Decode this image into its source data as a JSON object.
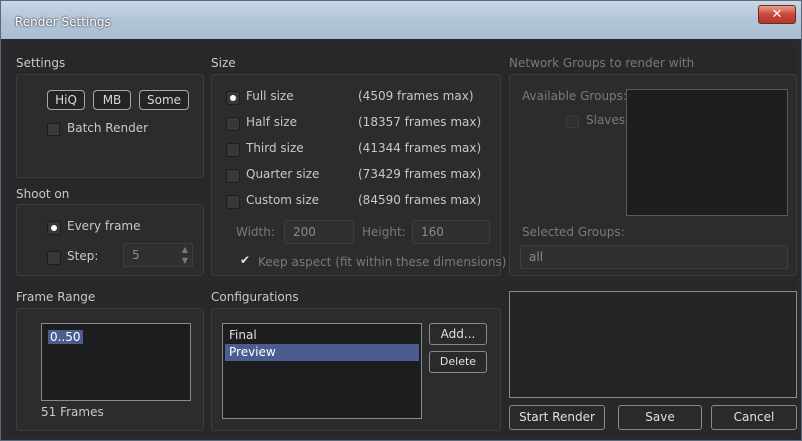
{
  "window": {
    "title": "Render Settings",
    "close_glyph": "✕"
  },
  "settings": {
    "heading": "Settings",
    "toggles": [
      "HiQ",
      "MB",
      "Some"
    ],
    "batch_render": "Batch Render"
  },
  "shoot_on": {
    "heading": "Shoot on",
    "every_frame": "Every frame",
    "step_label": "Step:",
    "step_value": "5"
  },
  "frame_range": {
    "heading": "Frame Range",
    "value": "0..50",
    "count": "51 Frames"
  },
  "size": {
    "heading": "Size",
    "options": [
      {
        "label": "Full size",
        "frames": "(4509 frames max)",
        "selected": true
      },
      {
        "label": "Half size",
        "frames": "(18357 frames max)",
        "selected": false
      },
      {
        "label": "Third size",
        "frames": "(41344 frames max)",
        "selected": false
      },
      {
        "label": "Quarter size",
        "frames": "(73429 frames max)",
        "selected": false
      },
      {
        "label": "Custom size",
        "frames": "(84590 frames max)",
        "selected": false
      }
    ],
    "width_label": "Width:",
    "width_value": "200",
    "height_label": "Height:",
    "height_value": "160",
    "keep_aspect": "Keep aspect (fit within these dimensions)",
    "check_glyph": "✔"
  },
  "configurations": {
    "heading": "Configurations",
    "items": [
      "Final",
      "Preview"
    ],
    "selected": "Preview",
    "add_label": "Add...",
    "delete_label": "Delete"
  },
  "network": {
    "heading": "Network Groups to render with",
    "available_label": "Available Groups:",
    "slaves_label": "Slaves",
    "selected_label": "Selected Groups:",
    "selected_value": "all"
  },
  "actions": {
    "start_render": "Start Render",
    "save": "Save",
    "cancel": "Cancel"
  },
  "colors": {
    "selection": "#4b5c8e",
    "titlebar": "#b3c5d8",
    "close": "#c9483a"
  }
}
